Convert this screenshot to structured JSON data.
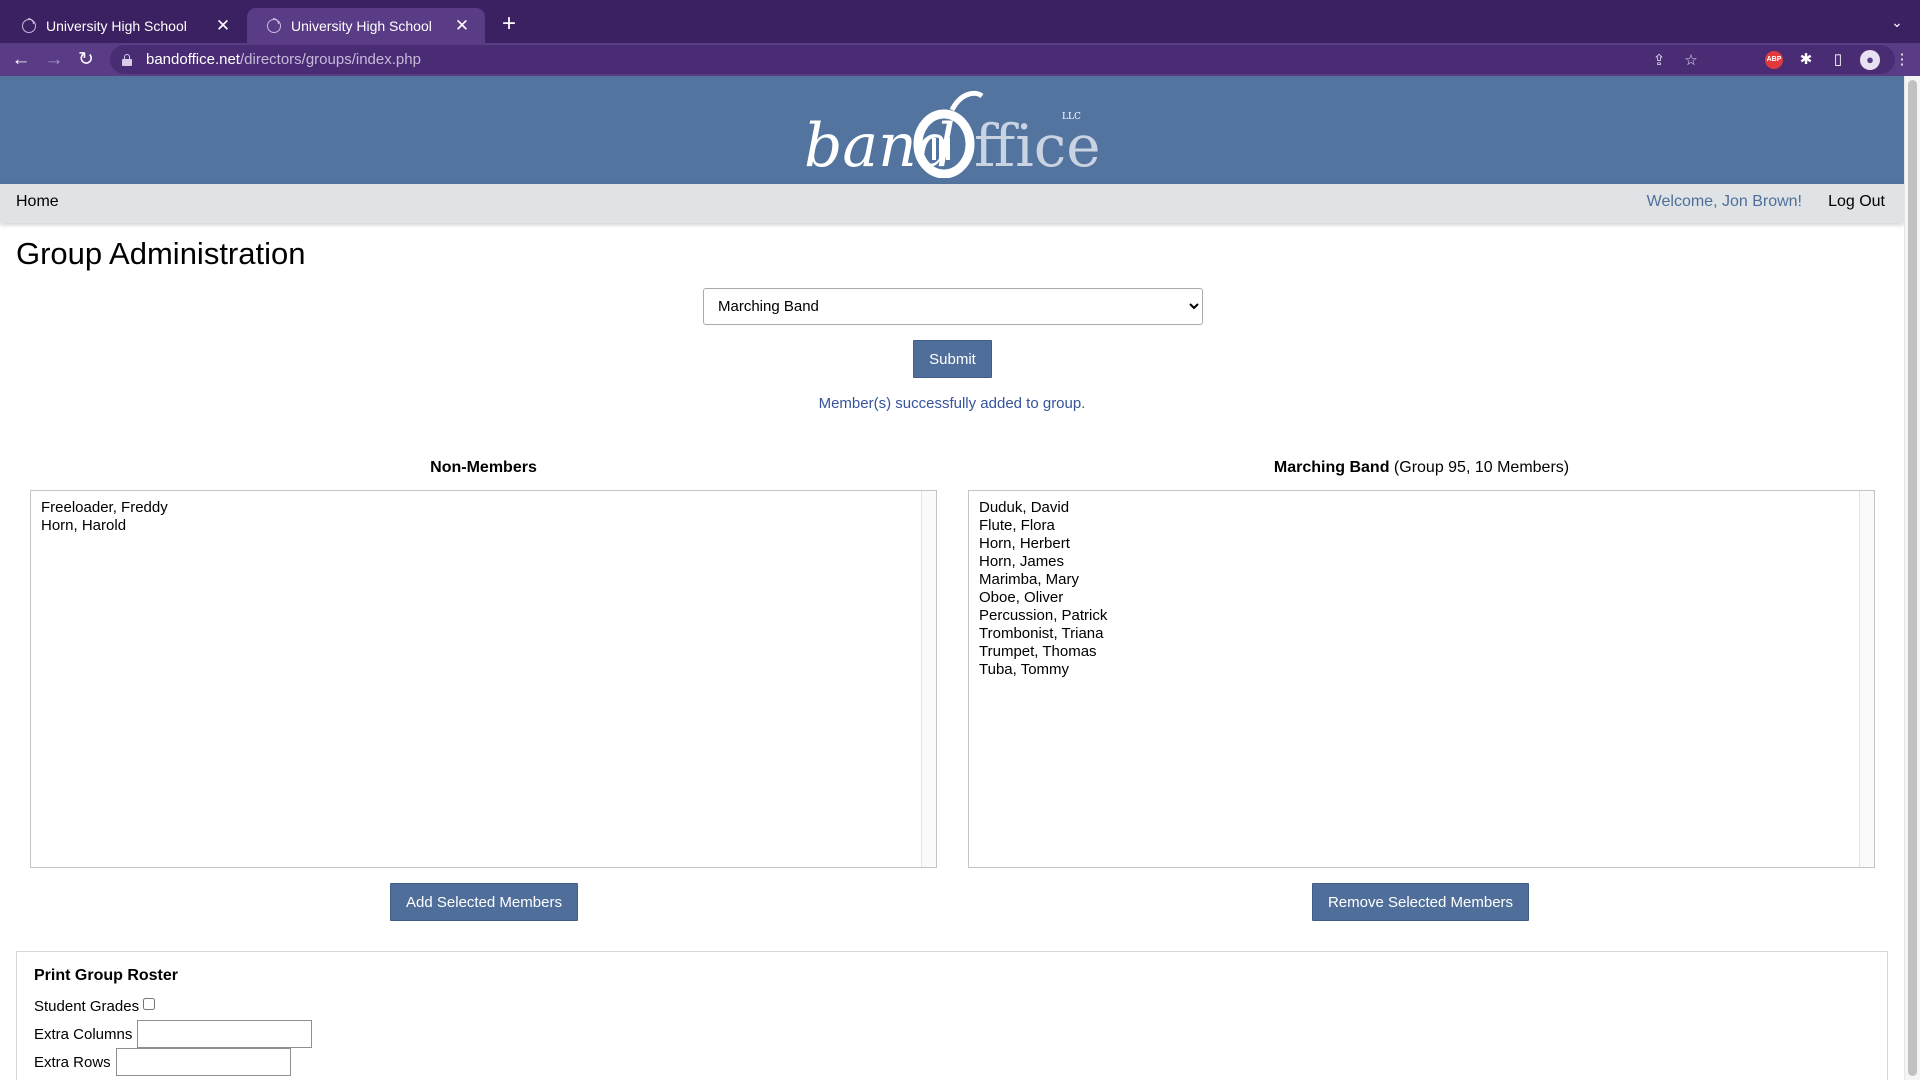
{
  "browser": {
    "tabs": [
      {
        "title": "University High School",
        "close": "✕"
      },
      {
        "title": "University High School",
        "close": "✕"
      }
    ],
    "new_tab": "+",
    "url_host": "bandoffice.net",
    "url_path": "/directors/groups/index.php",
    "accent_color": "#5a3b86",
    "icons": [
      "back-icon",
      "forward-icon",
      "reload-icon",
      "lock-icon",
      "share-icon",
      "star-icon",
      "adblock-icon",
      "extensions-icon",
      "sidepanel-icon",
      "profile-icon",
      "menu-icon"
    ]
  },
  "site": {
    "logo": {
      "word1": "band",
      "word2": "ffice",
      "llc": "LLC"
    },
    "header_color": "#52749f"
  },
  "nav": {
    "home": "Home",
    "welcome": "Welcome, Jon Brown!",
    "logout": "Log Out"
  },
  "page": {
    "title": "Group Administration",
    "selected_group": "Marching Band",
    "submit": "Submit",
    "message": "Member(s) successfully added to group."
  },
  "non_members": {
    "heading": "Non-Members",
    "items": [
      "Freeloader, Freddy",
      "Horn, Harold"
    ],
    "button": "Add Selected Members"
  },
  "members": {
    "heading_bold": "Marching Band",
    "heading_rest": " (Group 95, 10 Members)",
    "items": [
      "Duduk, David",
      "Flute, Flora",
      "Horn, Herbert",
      "Horn, James",
      "Marimba, Mary",
      "Oboe, Oliver",
      "Percussion, Patrick",
      "Trombonist, Triana",
      "Trumpet, Thomas",
      "Tuba, Tommy"
    ],
    "button": "Remove Selected Members"
  },
  "roster": {
    "title": "Print Group Roster",
    "student_grades": "Student Grades",
    "extra_columns": "Extra Columns",
    "extra_rows": "Extra Rows"
  }
}
